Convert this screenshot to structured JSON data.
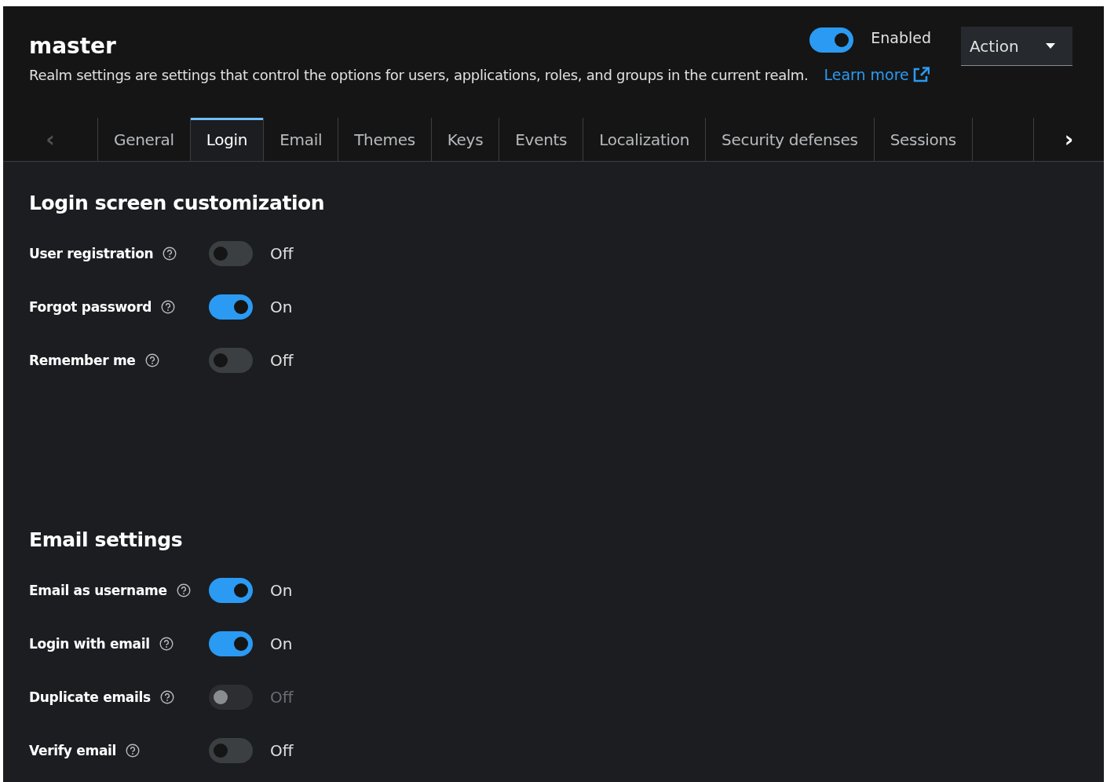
{
  "header": {
    "title": "master",
    "enabled": {
      "on": true,
      "label": "Enabled"
    },
    "action": {
      "label": "Action"
    },
    "description": "Realm settings are settings that control the options for users, applications, roles, and groups in the current realm.",
    "learn_more": "Learn more"
  },
  "tabs": {
    "prev_disabled": true,
    "next_disabled": false,
    "next_glyph": "›",
    "prev_glyph": "‹",
    "items": [
      {
        "label": "General",
        "selected": false
      },
      {
        "label": "Login",
        "selected": true
      },
      {
        "label": "Email",
        "selected": false
      },
      {
        "label": "Themes",
        "selected": false
      },
      {
        "label": "Keys",
        "selected": false
      },
      {
        "label": "Events",
        "selected": false
      },
      {
        "label": "Localization",
        "selected": false
      },
      {
        "label": "Security defenses",
        "selected": false
      },
      {
        "label": "Sessions",
        "selected": false
      }
    ]
  },
  "sections": [
    {
      "title": "Login screen customization",
      "settings": [
        {
          "label": "User registration",
          "on": false,
          "disabled": false,
          "state": "Off"
        },
        {
          "label": "Forgot password",
          "on": true,
          "disabled": false,
          "state": "On"
        },
        {
          "label": "Remember me",
          "on": false,
          "disabled": false,
          "state": "Off"
        }
      ]
    },
    {
      "title": "Email settings",
      "settings": [
        {
          "label": "Email as username",
          "on": true,
          "disabled": false,
          "state": "On"
        },
        {
          "label": "Login with email",
          "on": true,
          "disabled": false,
          "state": "On"
        },
        {
          "label": "Duplicate emails",
          "on": false,
          "disabled": true,
          "state": "Off"
        },
        {
          "label": "Verify email",
          "on": false,
          "disabled": false,
          "state": "Off"
        }
      ]
    }
  ]
}
